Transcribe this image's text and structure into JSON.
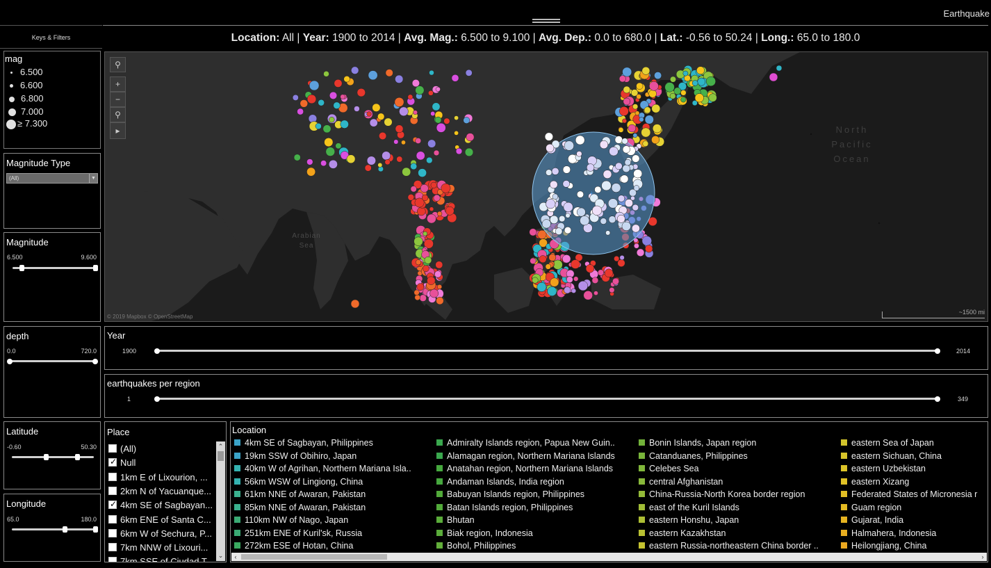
{
  "header": {
    "title": "Earthquake",
    "keys_filters": "Keys & Filters",
    "summary": [
      {
        "k": "Location:",
        "v": " All | "
      },
      {
        "k": "Year:",
        "v": " 1900 to 2014 | "
      },
      {
        "k": "Avg. Mag.:",
        "v": " 6.500 to 9.100 | "
      },
      {
        "k": "Avg. Dep.:",
        "v": " 0.0 to 680.0 | "
      },
      {
        "k": "Lat.:",
        "v": " -0.56 to 50.24 | "
      },
      {
        "k": "Long.:",
        "v": " 65.0 to 180.0"
      }
    ]
  },
  "mag_legend": {
    "title": "mag",
    "items": [
      "6.500",
      "6.600",
      "6.800",
      "7.000",
      "≥ 7.300"
    ]
  },
  "mag_type": {
    "title": "Magnitude Type",
    "value": "(All)"
  },
  "magnitude": {
    "title": "Magnitude",
    "min": "6.500",
    "max": "9.600"
  },
  "depth": {
    "title": "depth",
    "min": "0.0",
    "max": "720.0"
  },
  "latitude": {
    "title": "Latitude",
    "min": "-0.60",
    "max": "50.30"
  },
  "longitude": {
    "title": "Longitude",
    "min": "65.0",
    "max": "180.0"
  },
  "year": {
    "title": "Year",
    "min": "1900",
    "max": "2014"
  },
  "per_region": {
    "title": "earthquakes per region",
    "min": "1",
    "max": "349"
  },
  "map": {
    "labels": {
      "ocean1": "North",
      "ocean2": "Pacific",
      "ocean3": "Ocean",
      "arabian1": "Arabian",
      "arabian2": "Sea"
    },
    "attribution": "© 2019 Mapbox © OpenStreetMap",
    "scale": "~1500 mi"
  },
  "place": {
    "title": "Place",
    "items": [
      {
        "label": "(All)",
        "checked": false
      },
      {
        "label": "Null",
        "checked": true
      },
      {
        "label": "1km E of Lixourion, ...",
        "checked": false
      },
      {
        "label": "2km N of Yacuanque...",
        "checked": false
      },
      {
        "label": "4km SE of Sagbayan...",
        "checked": true
      },
      {
        "label": "6km ENE of Santa C...",
        "checked": false
      },
      {
        "label": "6km W of Sechura, P...",
        "checked": false
      },
      {
        "label": "7km NNW of Lixouri...",
        "checked": false
      },
      {
        "label": "7km SSE of Ciudad T...",
        "checked": false
      }
    ]
  },
  "location": {
    "title": "Location",
    "columns": [
      [
        {
          "label": "4km SE of Sagbayan, Philippines",
          "color": "#3aa3c8"
        },
        {
          "label": "19km SSW of Obihiro, Japan",
          "color": "#3aa3c8"
        },
        {
          "label": "40km W of Agrihan, Northern Mariana Isla..",
          "color": "#34b2b0"
        },
        {
          "label": "56km WSW of Lingiong, China",
          "color": "#34b2b0"
        },
        {
          "label": "61km NNE of Awaran, Pakistan",
          "color": "#3ab08e"
        },
        {
          "label": "85km NNE of Awaran, Pakistan",
          "color": "#3ab08e"
        },
        {
          "label": "110km NW of Nago, Japan",
          "color": "#3aaa74"
        },
        {
          "label": "251km ENE of Kuril'sk, Russia",
          "color": "#3aaa74"
        },
        {
          "label": "272km ESE of Hotan, China",
          "color": "#3aaa60"
        }
      ],
      [
        {
          "label": "Admiralty Islands region, Papua New Guin..",
          "color": "#3aa84e"
        },
        {
          "label": "Alamagan region, Northern Mariana Islands",
          "color": "#3aa84e"
        },
        {
          "label": "Anatahan region, Northern Mariana Islands",
          "color": "#46a83e"
        },
        {
          "label": "Andaman Islands, India region",
          "color": "#46a83e"
        },
        {
          "label": "Babuyan Islands region, Philippines",
          "color": "#52aa3a"
        },
        {
          "label": "Batan Islands region, Philippines",
          "color": "#52aa3a"
        },
        {
          "label": "Bhutan",
          "color": "#5aac3a"
        },
        {
          "label": "Biak region, Indonesia",
          "color": "#5aac3a"
        },
        {
          "label": "Bohol, Philippines",
          "color": "#62ae3a"
        }
      ],
      [
        {
          "label": "Bonin Islands, Japan region",
          "color": "#72b23a"
        },
        {
          "label": "Catanduanes, Philippines",
          "color": "#78b43a"
        },
        {
          "label": "Celebes Sea",
          "color": "#80b63a"
        },
        {
          "label": "central Afghanistan",
          "color": "#88b83a"
        },
        {
          "label": "China-Russia-North Korea border region",
          "color": "#94ba38"
        },
        {
          "label": "east of the Kuril Islands",
          "color": "#a0bc36"
        },
        {
          "label": "eastern Honshu, Japan",
          "color": "#acbe34"
        },
        {
          "label": "eastern Kazakhstan",
          "color": "#b8c032"
        },
        {
          "label": "eastern Russia-northeastern China border ..",
          "color": "#c4c230"
        }
      ],
      [
        {
          "label": "eastern Sea of Japan",
          "color": "#d2c42c"
        },
        {
          "label": "eastern Sichuan, China",
          "color": "#d8c42a"
        },
        {
          "label": "eastern Uzbekistan",
          "color": "#dcc428"
        },
        {
          "label": "eastern Xizang",
          "color": "#e0c226"
        },
        {
          "label": "Federated States of Micronesia r",
          "color": "#e2be24"
        },
        {
          "label": "Guam region",
          "color": "#e4ba22"
        },
        {
          "label": "Gujarat, India",
          "color": "#e6b420"
        },
        {
          "label": "Halmahera, Indonesia",
          "color": "#e8ae20"
        },
        {
          "label": "Heilongjiang, China",
          "color": "#eaa820"
        }
      ]
    ]
  }
}
